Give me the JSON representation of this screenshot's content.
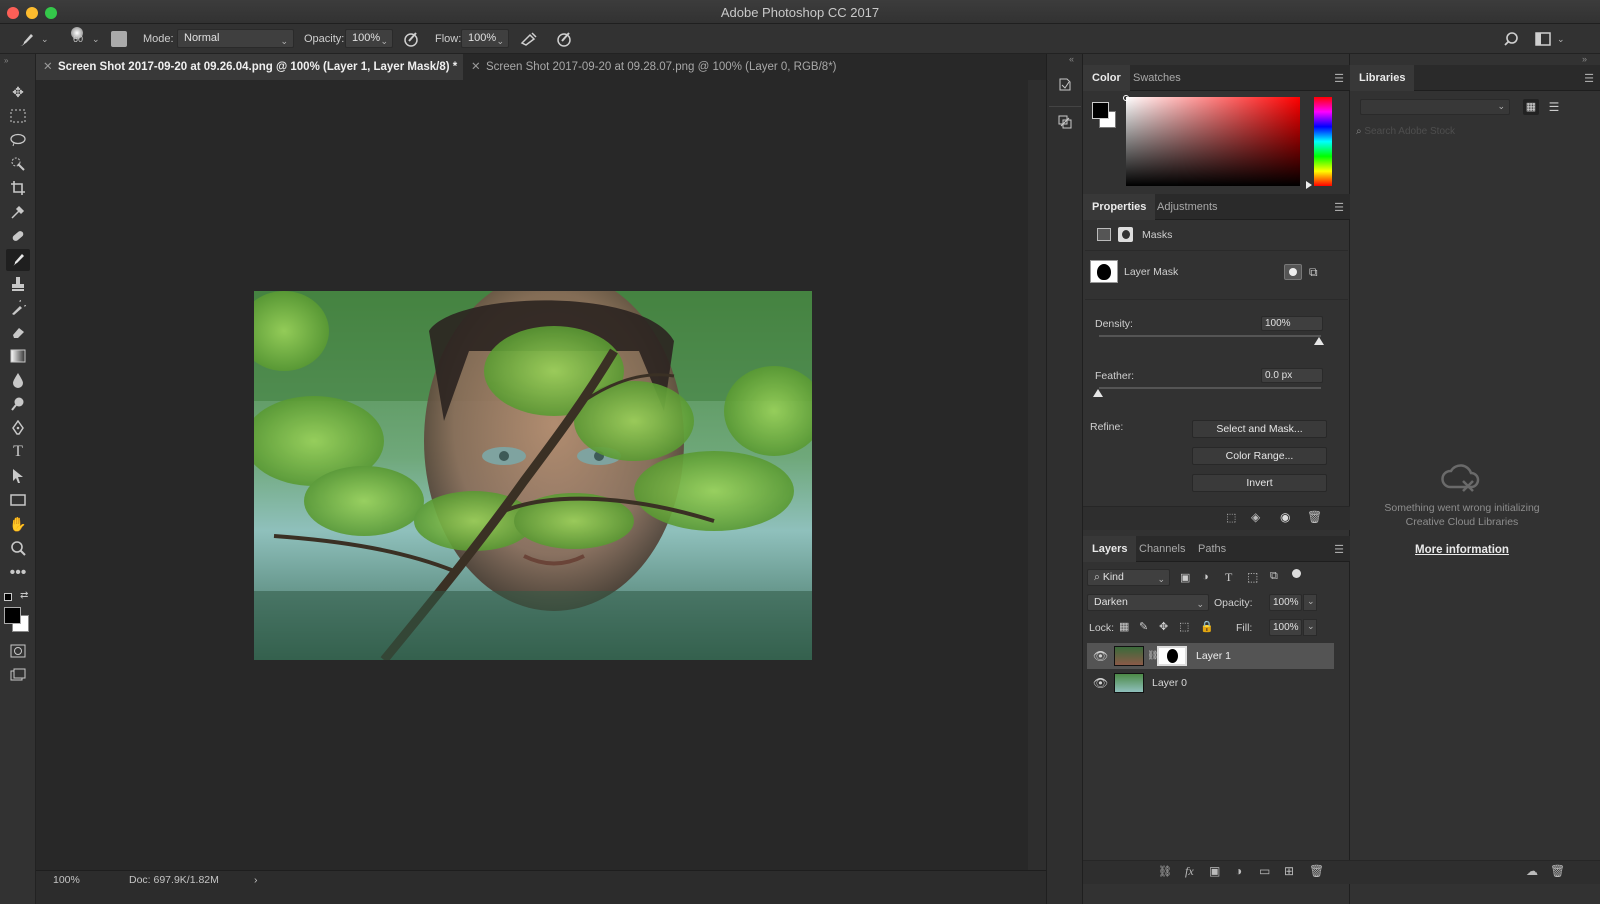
{
  "window": {
    "title": "Adobe Photoshop CC 2017"
  },
  "options_bar": {
    "brush_size": "60",
    "mode_label": "Mode:",
    "mode_value": "Normal",
    "opacity_label": "Opacity:",
    "opacity_value": "100%",
    "flow_label": "Flow:",
    "flow_value": "100%"
  },
  "document_tabs": [
    {
      "label": "Screen Shot 2017-09-20 at 09.26.04.png @ 100% (Layer 1, Layer Mask/8) *",
      "active": true
    },
    {
      "label": "Screen Shot 2017-09-20 at 09.28.07.png @ 100% (Layer 0, RGB/8*)",
      "active": false
    }
  ],
  "status_bar": {
    "zoom": "100%",
    "doc": "Doc: 697.9K/1.82M",
    "arrow": "›"
  },
  "color_panel": {
    "tabs": [
      "Color",
      "Swatches"
    ],
    "foreground": "#000000",
    "background": "#ffffff",
    "hue": "#ff0000"
  },
  "properties_panel": {
    "tabs": [
      "Properties",
      "Adjustments"
    ],
    "section": "Masks",
    "mask_name": "Layer Mask",
    "density_label": "Density:",
    "density_value": "100%",
    "feather_label": "Feather:",
    "feather_value": "0.0 px",
    "refine_label": "Refine:",
    "buttons": {
      "select_and_mask": "Select and Mask...",
      "color_range": "Color Range...",
      "invert": "Invert"
    }
  },
  "layers_panel": {
    "tabs": [
      "Layers",
      "Channels",
      "Paths"
    ],
    "filter_kind": "Kind",
    "blend_mode": "Darken",
    "opacity_label": "Opacity:",
    "opacity_value": "100%",
    "lock_label": "Lock:",
    "fill_label": "Fill:",
    "fill_value": "100%",
    "layers": [
      {
        "name": "Layer 1",
        "selected": true
      },
      {
        "name": "Layer 0",
        "selected": false
      }
    ]
  },
  "libraries_panel": {
    "tab": "Libraries",
    "search_placeholder": "Search Adobe Stock",
    "error_line1": "Something went wrong initializing",
    "error_line2": "Creative Cloud Libraries",
    "link": "More information"
  }
}
